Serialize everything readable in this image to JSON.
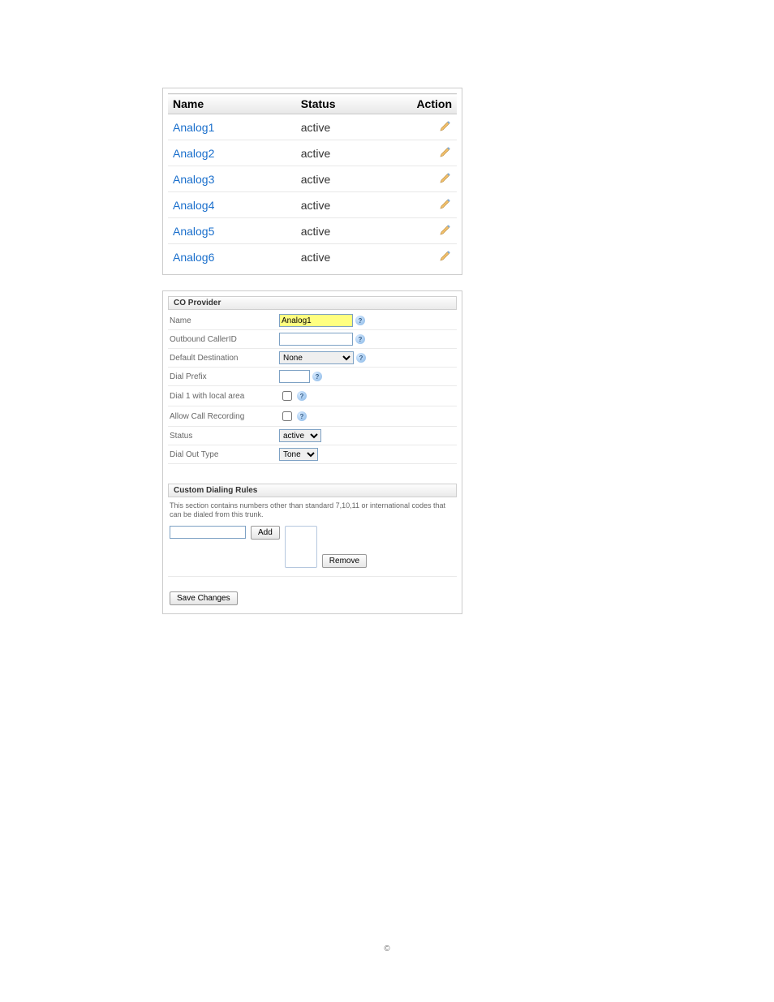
{
  "providers_table": {
    "headers": {
      "name": "Name",
      "status": "Status",
      "action": "Action"
    },
    "rows": [
      {
        "name": "Analog1",
        "status": "active"
      },
      {
        "name": "Analog2",
        "status": "active"
      },
      {
        "name": "Analog3",
        "status": "active"
      },
      {
        "name": "Analog4",
        "status": "active"
      },
      {
        "name": "Analog5",
        "status": "active"
      },
      {
        "name": "Analog6",
        "status": "active"
      }
    ]
  },
  "co_provider": {
    "title": "CO Provider",
    "fields": {
      "name": {
        "label": "Name",
        "value": "Analog1"
      },
      "outbound": {
        "label": "Outbound CallerID",
        "value": ""
      },
      "default_dest": {
        "label": "Default Destination",
        "value": "None"
      },
      "dial_prefix": {
        "label": "Dial Prefix",
        "value": ""
      },
      "dial1": {
        "label": "Dial 1 with local area",
        "checked": ""
      },
      "allow_rec": {
        "label": "Allow Call Recording",
        "checked": ""
      },
      "status": {
        "label": "Status",
        "value": "active"
      },
      "dial_out": {
        "label": "Dial Out Type",
        "value": "Tone"
      }
    }
  },
  "dialing_rules": {
    "title": "Custom Dialing Rules",
    "desc": "This section contains numbers other than standard 7,10,11 or international codes that can be dialed from this trunk.",
    "add_label": "Add",
    "remove_label": "Remove"
  },
  "save_label": "Save Changes",
  "footer": "©"
}
